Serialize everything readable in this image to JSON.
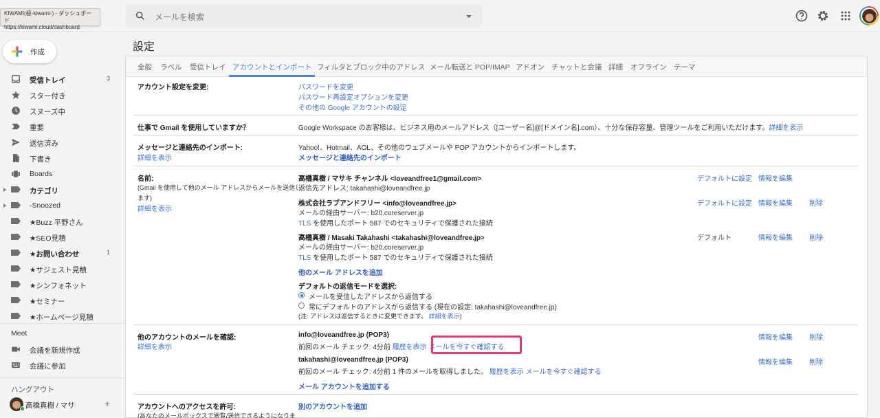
{
  "tooltip": {
    "title": "KIWAMI(極-kiwami-) - ダッシュボード",
    "url": "https://kiwami.cloud/dashboard"
  },
  "header": {
    "search_placeholder": "メールを検索",
    "icons": [
      "help-icon",
      "gear-icon",
      "apps-grid-icon",
      "account-avatar"
    ]
  },
  "sidebar": {
    "compose_label": "作成",
    "items": [
      {
        "label": "受信トレイ",
        "count": "3",
        "icon": "inbox-icon",
        "bold": true
      },
      {
        "label": "スター付き",
        "count": "",
        "icon": "star-icon"
      },
      {
        "label": "スヌーズ中",
        "count": "",
        "icon": "clock-icon"
      },
      {
        "label": "重要",
        "count": "",
        "icon": "important-icon"
      },
      {
        "label": "送信済み",
        "count": "",
        "icon": "send-icon"
      },
      {
        "label": "下書き",
        "count": "",
        "icon": "draft-icon"
      },
      {
        "label": "Boards",
        "count": "",
        "icon": "boards-icon"
      },
      {
        "label": "カテゴリ",
        "count": "",
        "icon": "label-icon",
        "bold": true,
        "expandable": true
      },
      {
        "label": "-Snoozed",
        "count": "",
        "icon": "label-icon",
        "expandable": true
      },
      {
        "label": "★Buzz 平野さん",
        "count": "",
        "icon": "label-icon"
      },
      {
        "label": "★SEO見積",
        "count": "",
        "icon": "label-icon"
      },
      {
        "label": "★お問い合わせ",
        "count": "1",
        "icon": "label-icon",
        "bold": true
      },
      {
        "label": "★サジェスト見積",
        "count": "",
        "icon": "label-icon"
      },
      {
        "label": "★シンフォネット",
        "count": "",
        "icon": "label-icon"
      },
      {
        "label": "★セミナー",
        "count": "",
        "icon": "label-icon"
      },
      {
        "label": "★ホームページ見積",
        "count": "",
        "icon": "label-icon"
      }
    ],
    "meet": {
      "title": "Meet",
      "items": [
        {
          "label": "会議を新規作成",
          "icon": "video-camera-icon"
        },
        {
          "label": "会議に参加",
          "icon": "keyboard-icon"
        }
      ]
    },
    "hangouts": {
      "title": "ハングアウト",
      "user": "高橋真樹 / マサ",
      "add": "+"
    }
  },
  "settings": {
    "title": "設定",
    "tabs": [
      "全般",
      "ラベル",
      "受信トレイ",
      "アカウントとインポート",
      "フィルタとブロック中のアドレス",
      "メール転送と POP/IMAP",
      "アドオン",
      "チャットと会議",
      "詳細",
      "オフライン",
      "テーマ"
    ],
    "active_tab": "アカウントとインポート",
    "sections": {
      "change_account": {
        "label": "アカウント設定を変更:",
        "links": [
          "パスワードを変更",
          "パスワード再設定オプションを変更",
          "その他の Google アカウントの設定"
        ]
      },
      "workspace": {
        "label": "仕事で Gmail を使用していますか？",
        "text": "Google Workspace のお客様は、ビジネス用のメールアドレス（[ユーザー名]@[ドメイン名].com）、十分な保存容量、管理ツールをご利用いただけます。",
        "link": "詳細を表示"
      },
      "import": {
        "label": "メッセージと連絡先のインポート:",
        "learn_more": "詳細を表示",
        "text": "Yahoo!、Hotmail、AOL、その他のウェブメールや POP アカウントからインポートします。",
        "action": "メッセージと連絡先のインポート"
      },
      "send_as": {
        "label": "名前:",
        "sublabel_1": "(Gmail を使用して他のメール アドレスからメールを送信し",
        "sublabel_2": "ます)",
        "learn_more": "詳細を表示",
        "accounts": [
          {
            "name": "高橋真樹 / マサキ チャンネル <loveandfree1@gmail.com>",
            "line1": "返信先アドレス: takahashi@loveandfree.jp",
            "line2_link": "",
            "line2": "",
            "default_action": "デフォルトに設定",
            "edit": "情報を編集",
            "delete": ""
          },
          {
            "name": "株式会社ラブアンドフリー <info@loveandfree.jp>",
            "line1": "メールの経由サーバー: b20.coreserver.jp",
            "line2_link": "TLS",
            "line2": " を使用したポート 587 でのセキュリティで保護された接続",
            "default_action": "デフォルトに設定",
            "edit": "情報を編集",
            "delete": "削除"
          },
          {
            "name": "高橋真樹 / Masaki Takahashi <takahashi@loveandfree.jp>",
            "line1": "メールの経由サーバー: b20.coreserver.jp",
            "line2_link": "TLS",
            "line2": " を使用したポート 587 でのセキュリティで保護された接続",
            "default_action": "デフォルト",
            "edit": "情報を編集",
            "delete": "削除"
          }
        ],
        "add_address": "他のメール アドレスを追加",
        "reply_mode_title": "デフォルトの返信モードを選択:",
        "reply_options": [
          {
            "label": "メールを受信したアドレスから返信する",
            "selected": true
          },
          {
            "label": "常にデフォルトのアドレスから返信する (現在の設定: takahashi@loveandfree.jp)",
            "selected": false
          }
        ],
        "note": "(注: アドレスは返信するときに変更できます。",
        "note_link": "詳細を表示",
        "note_end": ")"
      },
      "check_mail": {
        "label": "他のアカウントのメールを確認:",
        "learn_more": "詳細を表示",
        "accounts": [
          {
            "address": "info@loveandfree.jp (POP3)",
            "status": "前回のメール チェック: 4分前",
            "history": "履歴を表示",
            "check_now": "メールを今すぐ確認する",
            "edit": "情報を編集",
            "delete": "削除"
          },
          {
            "address": "takahashi@loveandfree.jp (POP3)",
            "status": "前回のメール チェック: 4分前 1 件のメールを取得しました。",
            "history": "履歴を表示",
            "check_now": "メールを今すぐ確認する",
            "edit": "情報を編集",
            "delete": "削除"
          }
        ],
        "add_account": "メール アカウントを追加する"
      },
      "grant_access": {
        "label": "アカウントへのアクセスを許可:",
        "sublabel": "(あなたのメールボックスで閲覧/送信できるようになりま",
        "action": "別のアカウントを追加"
      }
    },
    "highlight_color": "#e8357a",
    "link_color": "#3a6ed3"
  }
}
